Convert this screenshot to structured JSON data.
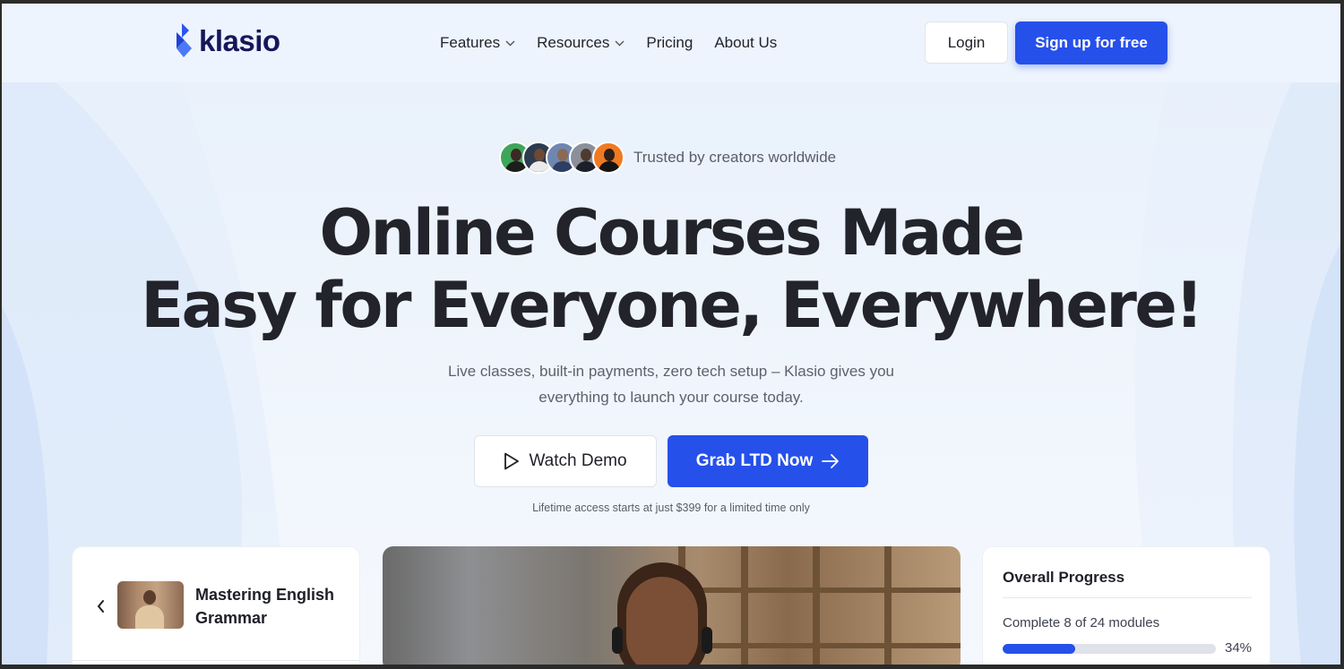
{
  "brand": {
    "name": "klasio",
    "color": "#2650ea"
  },
  "nav": {
    "items": [
      {
        "label": "Features",
        "has_dropdown": true
      },
      {
        "label": "Resources",
        "has_dropdown": true
      },
      {
        "label": "Pricing",
        "has_dropdown": false
      },
      {
        "label": "About Us",
        "has_dropdown": false
      }
    ],
    "login_label": "Login",
    "signup_label": "Sign up for free"
  },
  "hero": {
    "trusted_text": "Trusted by creators worldwide",
    "avatar_colors": [
      "#3fa55b",
      "#2d3a4f",
      "#6f87b0",
      "#8a8f99",
      "#f07a22"
    ],
    "title_line1": "Online Courses Made",
    "title_line2": "Easy for Everyone, Everywhere!",
    "subtitle_line1": "Live classes, built-in payments, zero tech setup – Klasio gives you",
    "subtitle_line2": "everything to launch your course today.",
    "watch_demo_label": "Watch Demo",
    "grab_ltd_label": "Grab LTD Now",
    "fine_print": "Lifetime access starts at just $399 for a limited time only"
  },
  "course_card": {
    "title": "Mastering English Grammar"
  },
  "progress_card": {
    "title": "Overall Progress",
    "subtitle": "Complete 8 of 24 modules",
    "percent_label": "34%",
    "percent": 34
  }
}
